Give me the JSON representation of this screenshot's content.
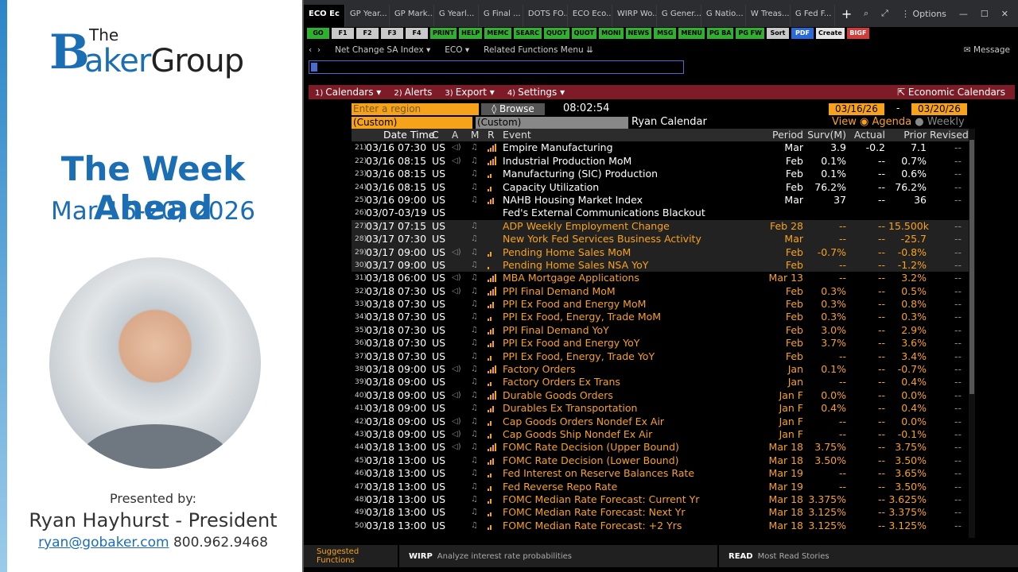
{
  "presentation": {
    "logo_the": "The",
    "logo_b": "B",
    "logo_aker": "aker",
    "logo_group": "Group",
    "title": "The Week Ahead",
    "dates": "Mar 16-20, 2026",
    "presented_by": "Presented by:",
    "presenter": "Ryan Hayhurst - President",
    "email": "ryan@gobaker.com",
    "phone": "800.962.9468"
  },
  "terminal": {
    "tabs": [
      {
        "label": "ECO Ec"
      },
      {
        "label": "GP Year..."
      },
      {
        "label": "GP Mark..."
      },
      {
        "label": "G Yearl..."
      },
      {
        "label": "G Final ..."
      },
      {
        "label": "DOTS FO..."
      },
      {
        "label": "ECO Eco..."
      },
      {
        "label": "WIRP Wo..."
      },
      {
        "label": "G Gener..."
      },
      {
        "label": "G Natio..."
      },
      {
        "label": "W Treas..."
      },
      {
        "label": "G Fed F..."
      }
    ],
    "tab_plus": "+",
    "options_label": "Options",
    "fkeys": [
      {
        "label": "GO",
        "style": "green"
      },
      {
        "label": "F1",
        "style": "gray"
      },
      {
        "label": "F2",
        "style": "gray"
      },
      {
        "label": "F3",
        "style": "gray"
      },
      {
        "label": "F4",
        "style": "gray"
      },
      {
        "label": "PRINT",
        "style": "green"
      },
      {
        "label": "HELP",
        "style": "green"
      },
      {
        "label": "MEMC",
        "style": "green"
      },
      {
        "label": "SEARC",
        "style": "green"
      },
      {
        "label": "QUOT",
        "style": "green"
      },
      {
        "label": "QUOT",
        "style": "green"
      },
      {
        "label": "MONI",
        "style": "green"
      },
      {
        "label": "NEWS",
        "style": "green"
      },
      {
        "label": "MSG",
        "style": "green"
      },
      {
        "label": "MENU",
        "style": "green"
      },
      {
        "label": "PG BA",
        "style": "green"
      },
      {
        "label": "PG FW",
        "style": "green"
      },
      {
        "label": "Sort",
        "style": "gray"
      },
      {
        "label": "PDF",
        "style": "blue"
      },
      {
        "label": "Create",
        "style": "white"
      },
      {
        "label": "BIGF",
        "style": "red"
      }
    ],
    "security": "Net Change SA Index",
    "function": "ECO",
    "related": "Related Functions Menu",
    "message": "Message",
    "menu": {
      "calendars": "Calendars",
      "alerts": "Alerts",
      "export": "Export",
      "settings": "Settings",
      "economic_calendars": "Economic Calendars"
    },
    "region_placeholder": "Enter a region",
    "browse": "Browse",
    "clock": "08:02:54",
    "start_date": "03/16/26",
    "end_date": "03/20/26",
    "custom1": "(Custom)",
    "custom2": "(Custom)",
    "calendar_name": "Ryan Calendar",
    "view_label": "View",
    "view_agenda": "Agenda",
    "view_weekly": "Weekly",
    "columns": {
      "datetime": "Date Time",
      "c": "C",
      "a": "A",
      "m": "M",
      "r": "R",
      "event": "Event",
      "period": "Period",
      "survey": "Surv(M)",
      "actual": "Actual",
      "prior": "Prior",
      "revised": "Revised"
    },
    "rows": [
      {
        "n": "21)",
        "dt": "03/16 07:30",
        "c": "US",
        "a": "◁)",
        "m": "♫",
        "r": 4,
        "event": "Empire Manufacturing",
        "per": "Mar",
        "sur": "3.9",
        "act": "-0.2",
        "pri": "7.1",
        "rev": "--",
        "white": true,
        "shade": false
      },
      {
        "n": "22)",
        "dt": "03/16 08:15",
        "c": "US",
        "a": "◁)",
        "m": "♫",
        "r": 4,
        "event": "Industrial Production MoM",
        "per": "Feb",
        "sur": "0.1%",
        "act": "--",
        "pri": "0.7%",
        "rev": "--",
        "white": true,
        "shade": false
      },
      {
        "n": "23)",
        "dt": "03/16 08:15",
        "c": "US",
        "a": "",
        "m": "♫",
        "r": 2,
        "event": "Manufacturing (SIC) Production",
        "per": "Feb",
        "sur": "0.1%",
        "act": "--",
        "pri": "0.6%",
        "rev": "--",
        "white": true,
        "shade": false
      },
      {
        "n": "24)",
        "dt": "03/16 08:15",
        "c": "US",
        "a": "",
        "m": "♫",
        "r": 2,
        "event": "Capacity Utilization",
        "per": "Feb",
        "sur": "76.2%",
        "act": "--",
        "pri": "76.2%",
        "rev": "--",
        "white": true,
        "shade": false
      },
      {
        "n": "25)",
        "dt": "03/16 09:00",
        "c": "US",
        "a": "",
        "m": "♫",
        "r": 3,
        "event": "NAHB Housing Market Index",
        "per": "Mar",
        "sur": "37",
        "act": "--",
        "pri": "36",
        "rev": "--",
        "white": true,
        "shade": false
      },
      {
        "n": "26)",
        "dt": "03/07-03/19",
        "c": "US",
        "a": "",
        "m": "",
        "r": 0,
        "event": "Fed's External Communications Blackout",
        "per": "",
        "sur": "",
        "act": "",
        "pri": "",
        "rev": "",
        "white": true,
        "shade": false
      },
      {
        "n": "27)",
        "dt": "03/17 07:15",
        "c": "US",
        "a": "",
        "m": "♫",
        "r": 0,
        "event": "ADP Weekly Employment Change",
        "per": "Feb 28",
        "sur": "--",
        "act": "--",
        "pri": "15.500k",
        "rev": "--",
        "white": false,
        "shade": true
      },
      {
        "n": "28)",
        "dt": "03/17 07:30",
        "c": "US",
        "a": "",
        "m": "♫",
        "r": 0,
        "event": "New York Fed Services Business Activity",
        "per": "Mar",
        "sur": "--",
        "act": "--",
        "pri": "-25.7",
        "rev": "--",
        "white": false,
        "shade": true
      },
      {
        "n": "29)",
        "dt": "03/17 09:00",
        "c": "US",
        "a": "◁)",
        "m": "♫",
        "r": 2,
        "event": "Pending Home Sales MoM",
        "per": "Feb",
        "sur": "-0.7%",
        "act": "--",
        "pri": "-0.8%",
        "rev": "--",
        "white": false,
        "shade": true
      },
      {
        "n": "30)",
        "dt": "03/17 09:00",
        "c": "US",
        "a": "",
        "m": "♫",
        "r": 1,
        "event": "Pending Home Sales NSA YoY",
        "per": "Feb",
        "sur": "--",
        "act": "--",
        "pri": "-1.2%",
        "rev": "--",
        "white": false,
        "shade": true
      },
      {
        "n": "31)",
        "dt": "03/18 06:00",
        "c": "US",
        "a": "◁)",
        "m": "♫",
        "r": 4,
        "event": "MBA Mortgage Applications",
        "per": "Mar 13",
        "sur": "--",
        "act": "--",
        "pri": "3.2%",
        "rev": "--",
        "white": false,
        "shade": false
      },
      {
        "n": "32)",
        "dt": "03/18 07:30",
        "c": "US",
        "a": "◁)",
        "m": "♫",
        "r": 4,
        "event": "PPI Final Demand MoM",
        "per": "Feb",
        "sur": "0.3%",
        "act": "--",
        "pri": "0.5%",
        "rev": "--",
        "white": false,
        "shade": false
      },
      {
        "n": "33)",
        "dt": "03/18 07:30",
        "c": "US",
        "a": "",
        "m": "♫",
        "r": 3,
        "event": "PPI Ex Food and Energy MoM",
        "per": "Feb",
        "sur": "0.3%",
        "act": "--",
        "pri": "0.8%",
        "rev": "--",
        "white": false,
        "shade": false
      },
      {
        "n": "34)",
        "dt": "03/18 07:30",
        "c": "US",
        "a": "",
        "m": "♫",
        "r": 2,
        "event": "PPI Ex Food, Energy, Trade MoM",
        "per": "Feb",
        "sur": "0.3%",
        "act": "--",
        "pri": "0.3%",
        "rev": "--",
        "white": false,
        "shade": false
      },
      {
        "n": "35)",
        "dt": "03/18 07:30",
        "c": "US",
        "a": "",
        "m": "♫",
        "r": 3,
        "event": "PPI Final Demand YoY",
        "per": "Feb",
        "sur": "3.0%",
        "act": "--",
        "pri": "2.9%",
        "rev": "--",
        "white": false,
        "shade": false
      },
      {
        "n": "36)",
        "dt": "03/18 07:30",
        "c": "US",
        "a": "",
        "m": "♫",
        "r": 3,
        "event": "PPI Ex Food and Energy YoY",
        "per": "Feb",
        "sur": "3.7%",
        "act": "--",
        "pri": "3.6%",
        "rev": "--",
        "white": false,
        "shade": false
      },
      {
        "n": "37)",
        "dt": "03/18 07:30",
        "c": "US",
        "a": "",
        "m": "♫",
        "r": 2,
        "event": "PPI Ex Food, Energy, Trade YoY",
        "per": "Feb",
        "sur": "--",
        "act": "--",
        "pri": "3.4%",
        "rev": "--",
        "white": false,
        "shade": false
      },
      {
        "n": "38)",
        "dt": "03/18 09:00",
        "c": "US",
        "a": "◁)",
        "m": "♫",
        "r": 4,
        "event": "Factory Orders",
        "per": "Jan",
        "sur": "0.1%",
        "act": "--",
        "pri": "-0.7%",
        "rev": "--",
        "white": false,
        "shade": false
      },
      {
        "n": "39)",
        "dt": "03/18 09:00",
        "c": "US",
        "a": "",
        "m": "♫",
        "r": 2,
        "event": "Factory Orders Ex Trans",
        "per": "Jan",
        "sur": "--",
        "act": "--",
        "pri": "0.4%",
        "rev": "--",
        "white": false,
        "shade": false
      },
      {
        "n": "40)",
        "dt": "03/18 09:00",
        "c": "US",
        "a": "◁)",
        "m": "♫",
        "r": 4,
        "event": "Durable Goods Orders",
        "per": "Jan F",
        "sur": "0.0%",
        "act": "--",
        "pri": "0.0%",
        "rev": "--",
        "white": false,
        "shade": false
      },
      {
        "n": "41)",
        "dt": "03/18 09:00",
        "c": "US",
        "a": "",
        "m": "♫",
        "r": 3,
        "event": "Durables Ex Transportation",
        "per": "Jan F",
        "sur": "0.4%",
        "act": "--",
        "pri": "0.4%",
        "rev": "--",
        "white": false,
        "shade": false
      },
      {
        "n": "42)",
        "dt": "03/18 09:00",
        "c": "US",
        "a": "◁)",
        "m": "♫",
        "r": 2,
        "event": "Cap Goods Orders Nondef Ex Air",
        "per": "Jan F",
        "sur": "--",
        "act": "--",
        "pri": "0.0%",
        "rev": "--",
        "white": false,
        "shade": false
      },
      {
        "n": "43)",
        "dt": "03/18 09:00",
        "c": "US",
        "a": "◁)",
        "m": "♫",
        "r": 2,
        "event": "Cap Goods Ship Nondef Ex Air",
        "per": "Jan F",
        "sur": "--",
        "act": "--",
        "pri": "-0.1%",
        "rev": "--",
        "white": false,
        "shade": false
      },
      {
        "n": "44)",
        "dt": "03/18 13:00",
        "c": "US",
        "a": "◁)",
        "m": "♫",
        "r": 4,
        "event": "FOMC Rate Decision (Upper Bound)",
        "per": "Mar 18",
        "sur": "3.75%",
        "act": "--",
        "pri": "3.75%",
        "rev": "--",
        "white": false,
        "shade": false
      },
      {
        "n": "45)",
        "dt": "03/18 13:00",
        "c": "US",
        "a": "",
        "m": "♫",
        "r": 3,
        "event": "FOMC Rate Decision (Lower Bound)",
        "per": "Mar 18",
        "sur": "3.50%",
        "act": "--",
        "pri": "3.50%",
        "rev": "--",
        "white": false,
        "shade": false
      },
      {
        "n": "46)",
        "dt": "03/18 13:00",
        "c": "US",
        "a": "",
        "m": "♫",
        "r": 2,
        "event": "Fed Interest on Reserve Balances Rate",
        "per": "Mar 19",
        "sur": "--",
        "act": "--",
        "pri": "3.65%",
        "rev": "--",
        "white": false,
        "shade": false
      },
      {
        "n": "47)",
        "dt": "03/18 13:00",
        "c": "US",
        "a": "",
        "m": "♫",
        "r": 2,
        "event": "Fed Reverse Repo Rate",
        "per": "Mar 19",
        "sur": "--",
        "act": "--",
        "pri": "3.50%",
        "rev": "--",
        "white": false,
        "shade": false
      },
      {
        "n": "48)",
        "dt": "03/18 13:00",
        "c": "US",
        "a": "",
        "m": "♫",
        "r": 2,
        "event": "FOMC Median Rate Forecast: Current Yr",
        "per": "Mar 18",
        "sur": "3.375%",
        "act": "--",
        "pri": "3.625%",
        "rev": "--",
        "white": false,
        "shade": false
      },
      {
        "n": "49)",
        "dt": "03/18 13:00",
        "c": "US",
        "a": "",
        "m": "♫",
        "r": 2,
        "event": "FOMC Median Rate Forecast: Next Yr",
        "per": "Mar 18",
        "sur": "3.125%",
        "act": "--",
        "pri": "3.375%",
        "rev": "--",
        "white": false,
        "shade": false
      },
      {
        "n": "50)",
        "dt": "03/18 13:00",
        "c": "US",
        "a": "",
        "m": "♫",
        "r": 2,
        "event": "FOMC Median Rate Forecast: +2 Yrs",
        "per": "Mar 18",
        "sur": "3.125%",
        "act": "--",
        "pri": "3.125%",
        "rev": "--",
        "white": false,
        "shade": false
      }
    ],
    "bottom": {
      "suggested": "Suggested Functions",
      "wirp_key": "WIRP",
      "wirp_desc": "Analyze interest rate probabilities",
      "read_key": "READ",
      "read_desc": "Most Read Stories"
    }
  }
}
